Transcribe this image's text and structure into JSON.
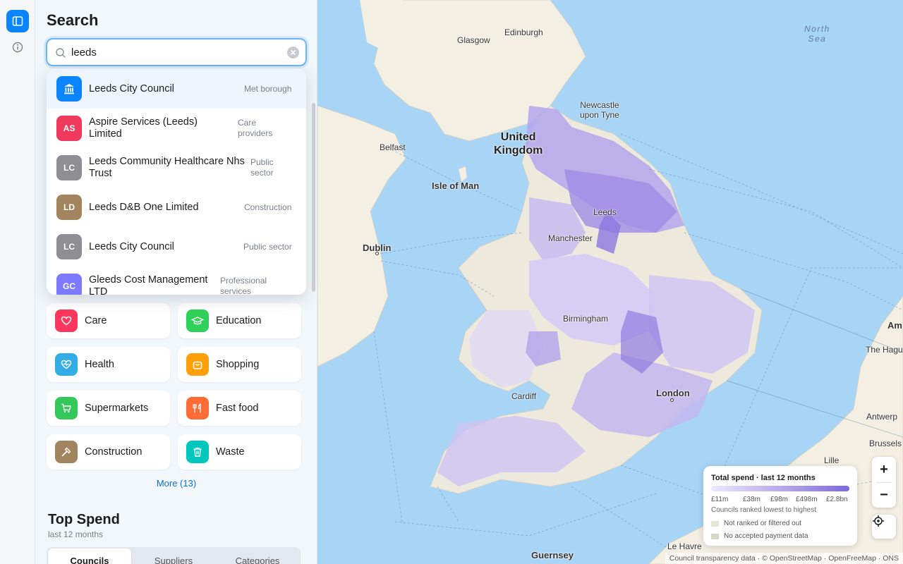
{
  "panel": {
    "title": "Search"
  },
  "search": {
    "value": "leeds",
    "placeholder": "Search"
  },
  "results": [
    {
      "initials": "",
      "icon": "bank-icon",
      "name": "Leeds City Council",
      "category": "Met borough",
      "color": "#0a84ff"
    },
    {
      "initials": "AS",
      "name": "Aspire Services (Leeds) Limited",
      "category": "Care providers",
      "color": "#ef3a5d"
    },
    {
      "initials": "LC",
      "name": "Leeds Community Healthcare Nhs Trust",
      "category": "Public sector",
      "color": "#8e8e93"
    },
    {
      "initials": "LD",
      "name": "Leeds D&B One Limited",
      "category": "Construction",
      "color": "#a2845e"
    },
    {
      "initials": "LC",
      "name": "Leeds City Council",
      "category": "Public sector",
      "color": "#8e8e93"
    },
    {
      "initials": "GC",
      "name": "Gleeds Cost Management LTD",
      "category": "Professional services",
      "color": "#7d7aff"
    }
  ],
  "categories": [
    {
      "label": "Care",
      "icon": "heart-icon",
      "color": "#ff375f"
    },
    {
      "label": "Education",
      "icon": "graduation-cap-icon",
      "color": "#30d158"
    },
    {
      "label": "Health",
      "icon": "health-heart-icon",
      "color": "#32ade6"
    },
    {
      "label": "Shopping",
      "icon": "shopping-bag-icon",
      "color": "#ff9f0a"
    },
    {
      "label": "Supermarkets",
      "icon": "cart-icon",
      "color": "#34c759"
    },
    {
      "label": "Fast food",
      "icon": "fork-knife-icon",
      "color": "#ff6b35"
    },
    {
      "label": "Construction",
      "icon": "hammer-icon",
      "color": "#a2845e"
    },
    {
      "label": "Waste",
      "icon": "trash-icon",
      "color": "#00c7be"
    }
  ],
  "more_label": "More (13)",
  "top_spend": {
    "title": "Top Spend",
    "subtitle": "last 12 months",
    "tabs": [
      "Councils",
      "Suppliers",
      "Categories"
    ],
    "active_tab": "Councils"
  },
  "map": {
    "labels": {
      "north_sea": "North\nSea",
      "edinburgh": "Edinburgh",
      "glasgow": "Glasgow",
      "newcastle": "Newcastle\nupon Tyne",
      "uk": "United\nKingdom",
      "belfast": "Belfast",
      "isle_of_man": "Isle of Man",
      "leeds": "Leeds",
      "manchester": "Manchester",
      "dublin": "Dublin",
      "birmingham": "Birmingham",
      "cardiff": "Cardiff",
      "london": "London",
      "guernsey": "Guernsey",
      "le_havre": "Le Havre",
      "lille": "Lille",
      "brussels": "Brussels",
      "antwerp": "Antwerp",
      "the_hague": "The Hague",
      "am": "Am"
    },
    "attribution": "Council transparency data · © OpenStreetMap · OpenFreeMap · ONS",
    "colors": {
      "sea": "#a8d4f5",
      "land": "#f3efe3",
      "choropleth_low": "#ece8fb",
      "choropleth_high": "#7c68de"
    }
  },
  "legend": {
    "title": "Total spend · last 12 months",
    "ticks": [
      "£11m",
      "£38m",
      "£98m",
      "£498m",
      "£2.8bn"
    ],
    "note": "Councils ranked lowest to highest",
    "rows": [
      {
        "label": "Not ranked or filtered out",
        "color": "#e4e6d4"
      },
      {
        "label": "No accepted payment data",
        "color": "#d5d8c4"
      }
    ]
  },
  "controls": {
    "zoom_in": "+",
    "zoom_out": "−"
  }
}
